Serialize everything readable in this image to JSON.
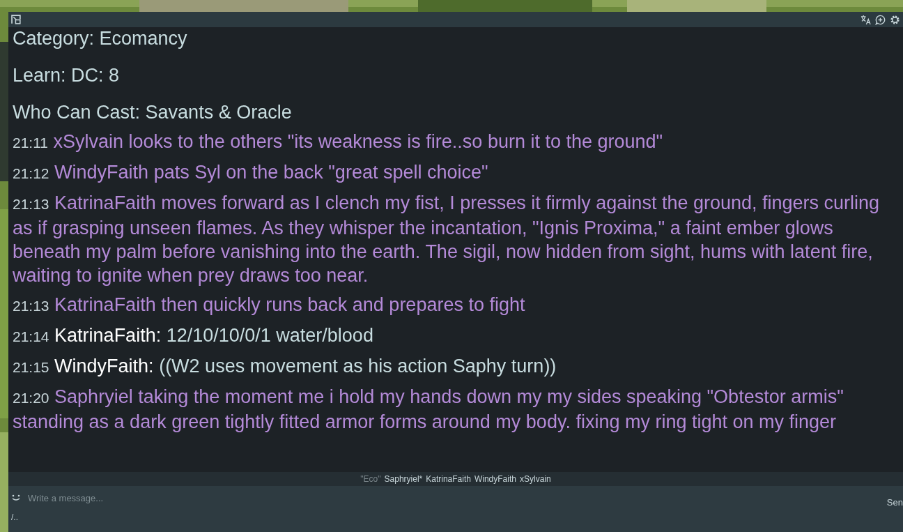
{
  "notices": [
    "Category: Ecomancy",
    "Learn: DC: 8",
    "Who Can Cast: Savants & Oracle"
  ],
  "messages": [
    {
      "time": "21:11",
      "kind": "emote",
      "name": "xSylvain",
      "text": "looks to the others \"its weakness is fire..so burn it to the ground\""
    },
    {
      "time": "21:12",
      "kind": "emote",
      "name": "WindyFaith",
      "text": "pats Syl on the back   \"great spell choice\""
    },
    {
      "time": "21:13",
      "kind": "emote",
      "name": "KatrinaFaith",
      "text": "moves forward as I clench my fist, I presses it firmly against the ground, fingers curling as if grasping unseen flames. As they whisper the incantation, \"Ignis Proxima,\" a faint ember glows beneath my palm before vanishing into the earth. The sigil, now hidden from sight, hums with latent fire, waiting to ignite when prey draws too near."
    },
    {
      "time": "21:13",
      "kind": "emote",
      "name": "KatrinaFaith",
      "text": "then quickly runs back and prepares to fight"
    },
    {
      "time": "21:14",
      "kind": "say",
      "name": "KatrinaFaith:",
      "text": "12/10/10/0/1 water/blood"
    },
    {
      "time": "21:15",
      "kind": "say",
      "name": "WindyFaith:",
      "text": "((W2 uses movement as his action  Saphy turn))"
    },
    {
      "time": "21:20",
      "kind": "emote",
      "name": "Saphryiel",
      "text": "taking the moment me i hold my hands down my my sides speaking \"Obtestor armis\" standing as a dark green tightly fitted armor forms around my body.  fixing my ring tight on my finger"
    }
  ],
  "channel": "\"Eco\"",
  "users": [
    "Saphryiel*",
    "KatrinaFaith",
    "WindyFaith",
    "xSylvain"
  ],
  "input": {
    "placeholder": "Write a message..."
  },
  "send_label": "Sen",
  "hint": "/.."
}
